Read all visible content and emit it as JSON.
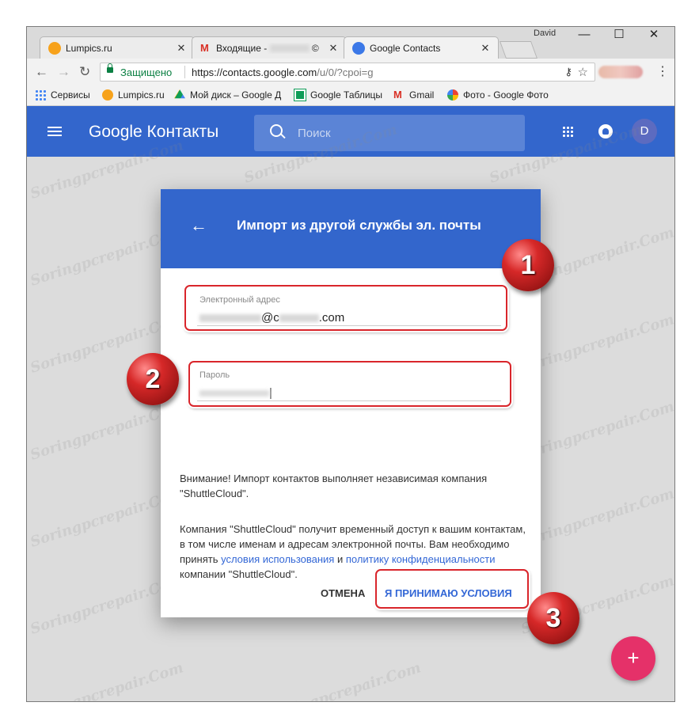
{
  "browser": {
    "profile_name": "David",
    "tabs": [
      {
        "title": "Lumpics.ru",
        "favicon_color": "#f7a21b"
      },
      {
        "title": "Входящие -",
        "favicon_color": "#d93025",
        "suffix": "©"
      },
      {
        "title": "Google Contacts",
        "favicon_color": "#3b78e7"
      }
    ],
    "window_controls": {
      "minimize": "—",
      "maximize": "☐",
      "close": "✕"
    },
    "nav": {
      "back": "←",
      "forward": "→",
      "reload": "↻"
    },
    "omnibox": {
      "secure_label": "Защищено",
      "url_host": "https://contacts.google.com",
      "url_path": "/u/0/?cpoi=g"
    },
    "bookmarks": [
      {
        "label": "Сервисы",
        "icon": "apps-icon",
        "color": "#4285f4"
      },
      {
        "label": "Lumpics.ru",
        "icon": "lumpics-icon",
        "color": "#f7a21b"
      },
      {
        "label": "Мой диск – Google Д",
        "icon": "drive-icon",
        "color": "#0f9d58"
      },
      {
        "label": "Google Таблицы",
        "icon": "sheets-icon",
        "color": "#0f9d58"
      },
      {
        "label": "Gmail",
        "icon": "gmail-icon",
        "color": "#d93025"
      },
      {
        "label": "Фото - Google Фото",
        "icon": "photos-icon",
        "color": "#fbbc04"
      }
    ]
  },
  "app": {
    "brand": "Google Контакты",
    "search_placeholder": "Поиск",
    "avatar_letter": "D",
    "accent": "#3366cc"
  },
  "dialog": {
    "title": "Импорт из другой службы эл. почты",
    "email_label": "Электронный адрес",
    "email_middle": "@c",
    "email_suffix": ".com",
    "password_label": "Пароль",
    "warning_1": "Внимание! Импорт контактов выполняет независимая компания \"ShuttleCloud\".",
    "warning_2_a": "Компания \"ShuttleCloud\" получит временный доступ к вашим контактам, в том числе именам и адресам электронной почты. Вам необходимо принять ",
    "terms_link": "условия использования",
    "and": " и ",
    "privacy_link": "политику конфиденциальности",
    "warning_2_b": " компании \"ShuttleCloud\".",
    "cancel": "ОТМЕНА",
    "accept": "Я ПРИНИМАЮ УСЛОВИЯ"
  },
  "callouts": [
    "1",
    "2",
    "3"
  ],
  "fab_label": "+",
  "watermark": "Soringpcrepair.Com"
}
